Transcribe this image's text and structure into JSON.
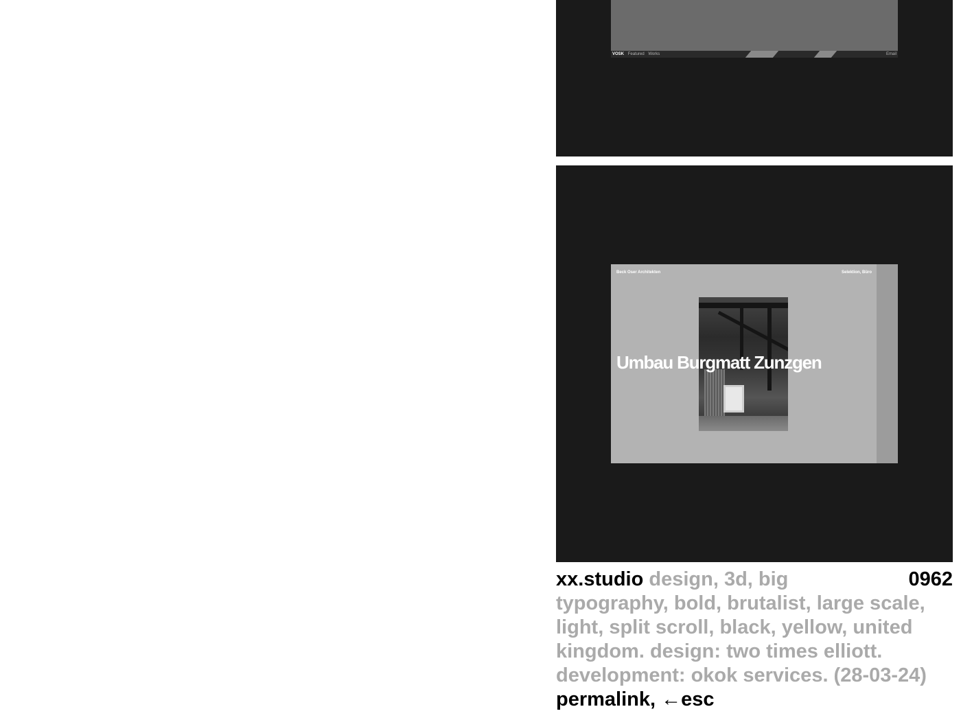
{
  "top_preview": {
    "brand": "VOSK",
    "nav": [
      "Featured",
      "Works"
    ],
    "email": "Email"
  },
  "bottom_preview": {
    "client": "Beck Oser Architekten",
    "tags": "Selektion, Büro",
    "title": "Umbau Burgmatt Zunzgen"
  },
  "caption": {
    "name": "xx.studio",
    "tags": "design, 3d, big typography, bold, brutalist, large scale, light, split scroll, black, yellow, united kingdom. design: two times elliott. development: okok services. (28-03-24)",
    "number": "0962",
    "permalink": "permalink,",
    "esc": "←esc"
  },
  "colors": {
    "panel_bg": "#1a1a1a",
    "muted_text": "#aaaaaa",
    "text": "#000000"
  }
}
